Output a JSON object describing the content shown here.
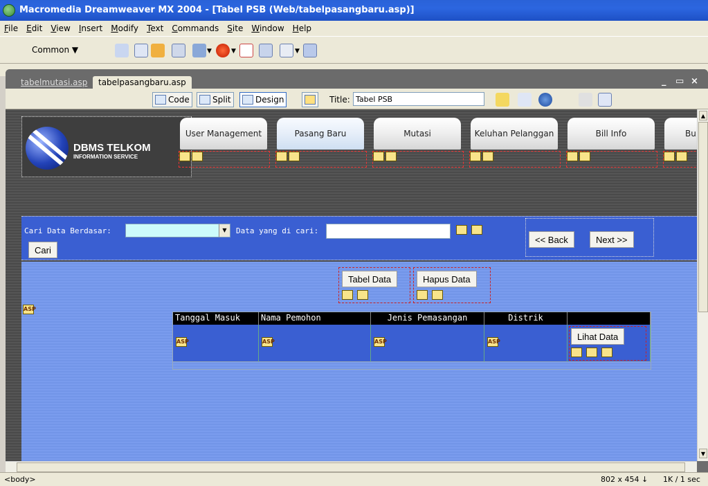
{
  "window": {
    "title": "Macromedia Dreamweaver MX 2004 - [Tabel PSB (Web/tabelpasangbaru.asp)]"
  },
  "menu": [
    "File",
    "Edit",
    "View",
    "Insert",
    "Modify",
    "Text",
    "Commands",
    "Site",
    "Window",
    "Help"
  ],
  "insert_toolbar": {
    "category": "Common ▼"
  },
  "doc_tabs": [
    "tabelmutasi.asp",
    "tabelpasangbaru.asp"
  ],
  "window_controls": {
    "minimize": "_",
    "restore": "×"
  },
  "doc_toolbar": {
    "code": "Code",
    "split": "Split",
    "design": "Design",
    "title_label": "Title:",
    "title_value": "Tabel PSB"
  },
  "page": {
    "logo_title": "DBMS TELKOM",
    "logo_subtitle": "INFORMATION SERVICE",
    "nav_tabs": [
      "User Management",
      "Pasang Baru",
      "Mutasi",
      "Keluhan Pelanggan",
      "Bill Info",
      "Bu"
    ],
    "search_label": "Cari Data Berdasar:",
    "data_label": "Data yang di cari:",
    "cari_button": "Cari",
    "back_button": "<< Back",
    "next_button": "Next >>",
    "tabel_data_button": "Tabel Data",
    "hapus_data_button": "Hapus Data",
    "table_headers": [
      "Tanggal Masuk",
      "Nama Pemohon",
      "Jenis Pemasangan",
      "Distrik",
      ""
    ],
    "lihat_data_button": "Lihat Data",
    "asp_icon_label": "ASP"
  },
  "status": {
    "tag": "<body>",
    "size": "802 x 454 ↓",
    "download": "1K / 1 sec"
  }
}
